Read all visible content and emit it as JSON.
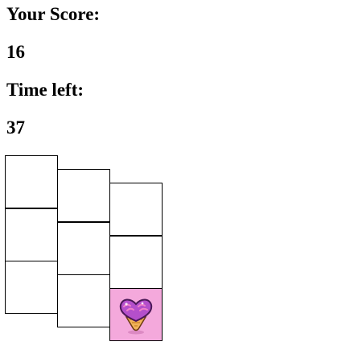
{
  "score": {
    "label": "Your Score:",
    "value": "16"
  },
  "timer": {
    "label": "Time left:",
    "value": "37"
  },
  "board": {
    "columns": 3,
    "rows": 3,
    "active_cell": {
      "column": 3,
      "row": 3
    },
    "active_cell_color": "#f4a9dc",
    "active_cell_icon": "ice-cream-heart-icon"
  }
}
